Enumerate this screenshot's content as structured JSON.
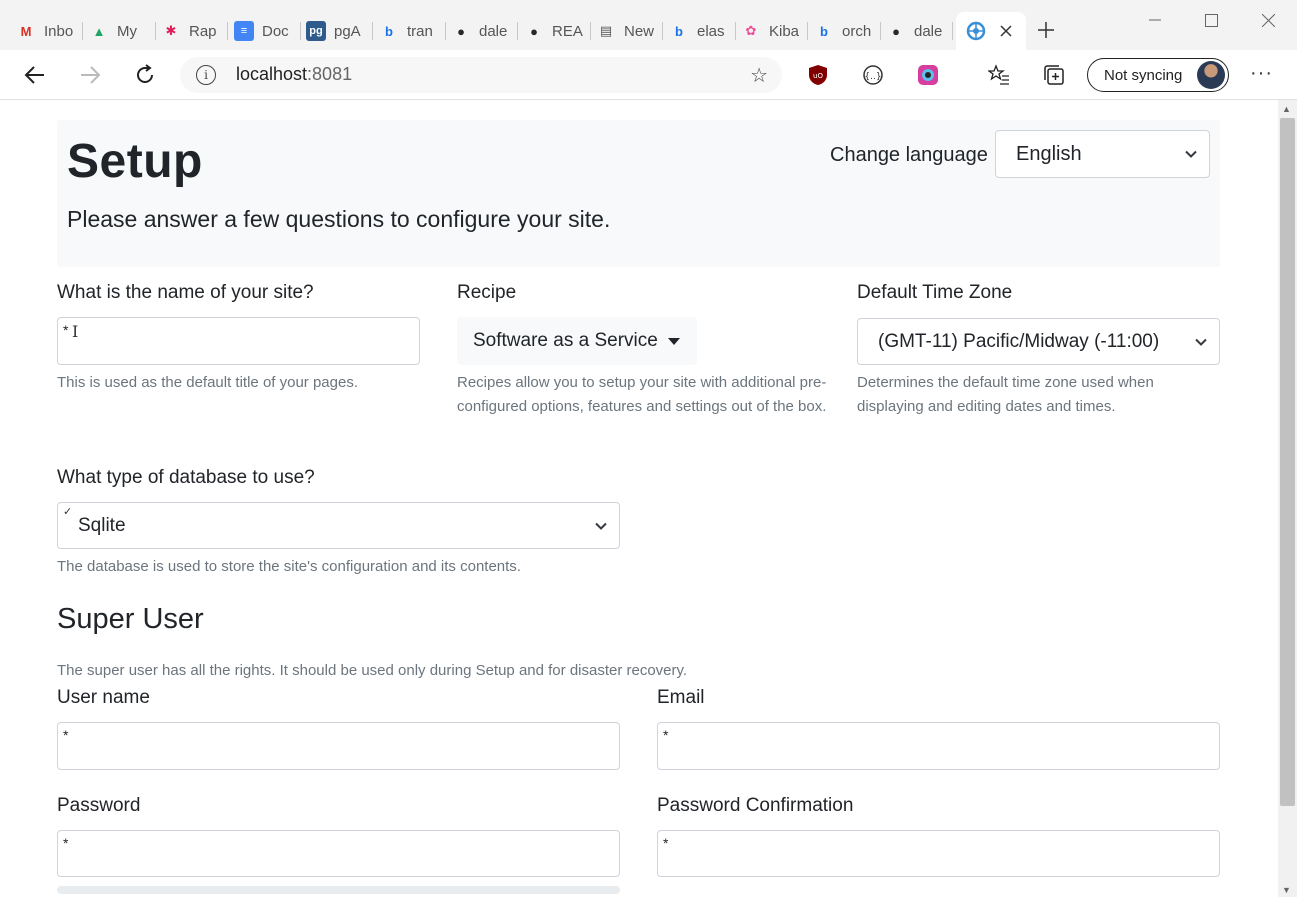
{
  "browser": {
    "tabs": [
      {
        "label": "Inbo",
        "icon": "gmail-icon",
        "color": "#d93025"
      },
      {
        "label": "My",
        "icon": "google-drive-icon",
        "color": "#1fa463"
      },
      {
        "label": "Rap",
        "icon": "slack-icon",
        "color": "#e01e5a"
      },
      {
        "label": "Doc",
        "icon": "google-docs-icon",
        "color": "#4285f4"
      },
      {
        "label": "pgA",
        "icon": "pgadmin-icon",
        "color": "#2f5b8c"
      },
      {
        "label": "tran",
        "icon": "bing-icon",
        "color": "#1a73e8"
      },
      {
        "label": "dale",
        "icon": "github-icon",
        "color": "#24292e"
      },
      {
        "label": "REA",
        "icon": "github-icon",
        "color": "#24292e"
      },
      {
        "label": "New",
        "icon": "newspaper-icon",
        "color": "#555555"
      },
      {
        "label": "elas",
        "icon": "bing-icon",
        "color": "#1a73e8"
      },
      {
        "label": "Kiba",
        "icon": "kibana-icon",
        "color": "#f04e98"
      },
      {
        "label": "orch",
        "icon": "bing-icon",
        "color": "#1a73e8"
      },
      {
        "label": "dale",
        "icon": "github-icon",
        "color": "#24292e"
      }
    ],
    "active_tab_icon": "orchard-icon",
    "url_host": "localhost",
    "url_port": ":8081",
    "sync_label": "Not syncing"
  },
  "page": {
    "title": "Setup",
    "lead": "Please answer a few questions to configure your site.",
    "change_language_label": "Change language",
    "language_value": "English",
    "site_name": {
      "label": "What is the name of your site?",
      "required_marker": "*",
      "help": "This is used as the default title of your pages."
    },
    "recipe": {
      "label": "Recipe",
      "value": "Software as a Service",
      "help": "Recipes allow you to setup your site with additional pre-configured options, features and settings out of the box."
    },
    "timezone": {
      "label": "Default Time Zone",
      "value": "(GMT-11) Pacific/Midway (-11:00)",
      "help": "Determines the default time zone used when displaying and editing dates and times."
    },
    "database": {
      "label": "What type of database to use?",
      "value": "Sqlite",
      "help": "The database is used to store the site's configuration and its contents."
    },
    "super_user": {
      "heading": "Super User",
      "help": "The super user has all the rights. It should be used only during Setup and for disaster recovery.",
      "username_label": "User name",
      "email_label": "Email",
      "password_label": "Password",
      "password_confirm_label": "Password Confirmation",
      "required_marker": "*"
    }
  }
}
